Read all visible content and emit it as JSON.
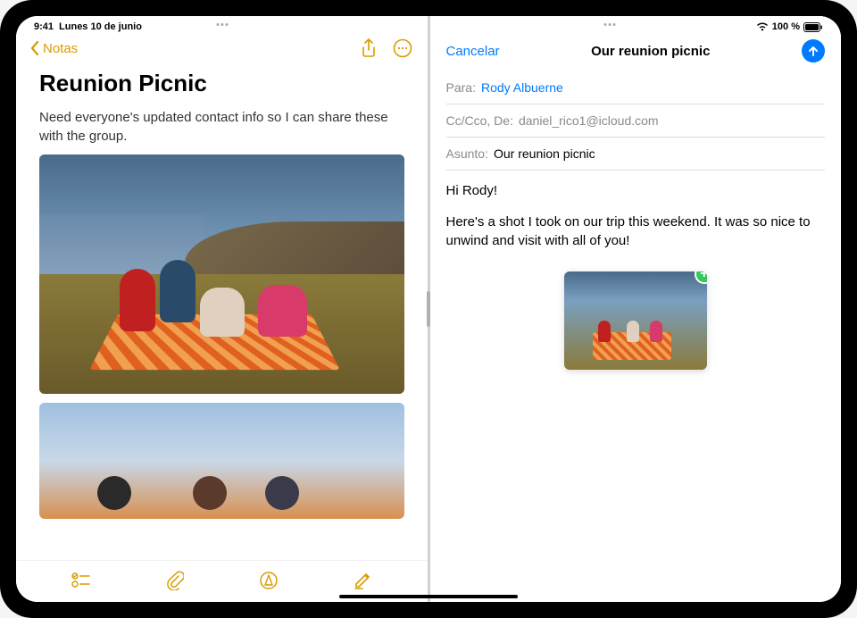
{
  "status": {
    "time": "9:41",
    "date": "Lunes 10 de junio",
    "battery": "100 %"
  },
  "notes": {
    "back_label": "Notas",
    "title": "Reunion Picnic",
    "body": "Need everyone's updated contact info so I can share these with the group."
  },
  "mail": {
    "cancel_label": "Cancelar",
    "title": "Our reunion picnic",
    "to_label": "Para:",
    "to_value": "Rody Albuerne",
    "cc_label": "Cc/Cco, De:",
    "cc_value": "daniel_rico1@icloud.com",
    "subject_label": "Asunto:",
    "subject_value": "Our reunion picnic",
    "greeting": "Hi Rody!",
    "body": "Here's a shot I took on our trip this weekend. It was so nice to unwind and visit with all of you!"
  }
}
